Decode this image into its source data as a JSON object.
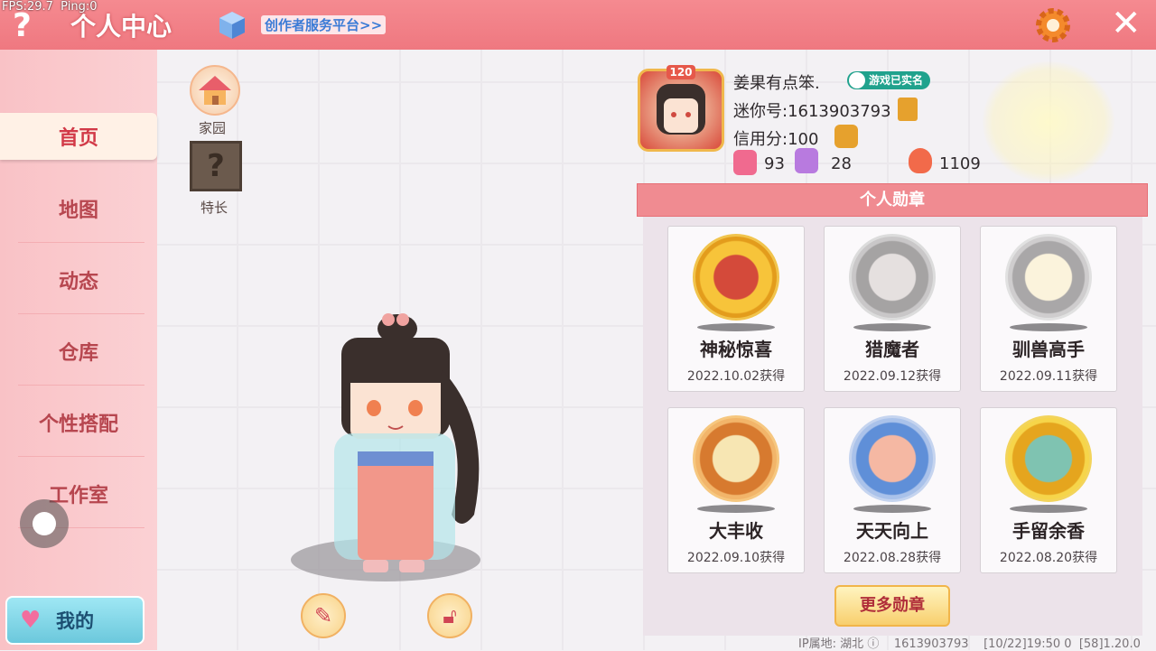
{
  "debug": {
    "fps_text": "FPS:29.7  Ping:0"
  },
  "header": {
    "help_icon": "?",
    "title": "个人中心",
    "creator_link": "创作者服务平台>>",
    "settings_icon": "gear-icon",
    "close_icon": "✕"
  },
  "sidebar": {
    "items": [
      {
        "label": "首页",
        "active": true
      },
      {
        "label": "地图"
      },
      {
        "label": "动态"
      },
      {
        "label": "仓库"
      },
      {
        "label": "个性搭配"
      },
      {
        "label": "工作室"
      }
    ],
    "my_button": "我的"
  },
  "quick": {
    "home_label": "家园",
    "talent_label": "特长",
    "talent_icon": "?"
  },
  "profile": {
    "level": "120",
    "name": "姜果有点笨.",
    "verified": "游戏已实名",
    "mini_id": "迷你号:1613903793",
    "credit": "信用分:100",
    "stats": [
      {
        "icon": "plus-badge-icon",
        "value": "93",
        "color": "#f06a8f"
      },
      {
        "icon": "cheer-icon",
        "value": "28",
        "color": "#b87adf"
      },
      {
        "icon": "flame-icon",
        "value": "1109",
        "color": "#f26a4a"
      }
    ]
  },
  "medals": {
    "header": "个人勋章",
    "items": [
      {
        "name": "神秘惊喜",
        "date": "2022.10.02获得",
        "style": "gold"
      },
      {
        "name": "猎魔者",
        "date": "2022.09.12获得",
        "style": "silver"
      },
      {
        "name": "驯兽高手",
        "date": "2022.09.11获得",
        "style": "silver2"
      },
      {
        "name": "大丰收",
        "date": "2022.09.10获得",
        "style": "bronze"
      },
      {
        "name": "天天向上",
        "date": "2022.08.28获得",
        "style": "blue"
      },
      {
        "name": "手留余香",
        "date": "2022.08.20获得",
        "style": "gold2"
      }
    ],
    "more_button": "更多勋章"
  },
  "footer": {
    "text": "IP属地: 湖北 ⓘ    1613903793    [10/22]19:50 0  [58]1.20.0"
  }
}
